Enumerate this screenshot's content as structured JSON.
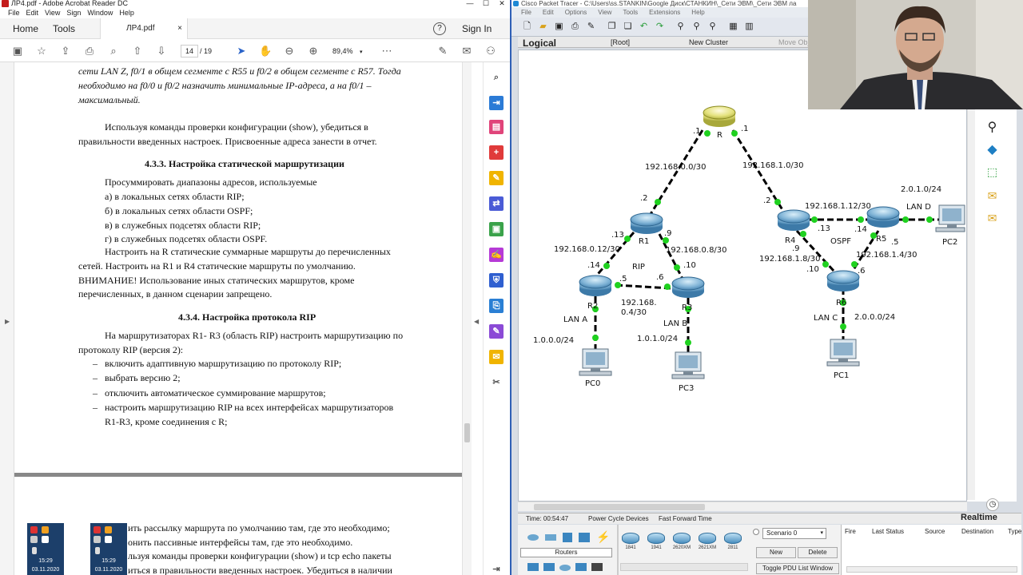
{
  "acrobat": {
    "window_title": "ЛР4.pdf - Adobe Acrobat Reader DC",
    "window_buttons": [
      "—",
      "☐",
      "✕"
    ],
    "menu": [
      "File",
      "Edit",
      "View",
      "Sign",
      "Window",
      "Help"
    ],
    "tabs": {
      "home": "Home",
      "tools": "Tools",
      "document": "ЛР4.pdf",
      "close": "×",
      "help": "?",
      "sign_in": "Sign In"
    },
    "toolbar": {
      "page_current": "14",
      "page_total": "/ 19",
      "zoom": "89,4%"
    },
    "page1": {
      "l1": "сети LAN Z, f0/1 в общем сегменте с R55 и f0/2 в общем сегменте с R57. Тогда",
      "l2": "необходимо на f0/0 и f0/2 назначить минимальные IP-адреса, а на f0/1 –",
      "l3": "максимальный.",
      "l4": "Используя команды проверки конфигурации (show), убедиться в",
      "l5": "правильности введенных настроек. Присвоенные адреса занести в отчет.",
      "h1": "4.3.3. Настройка статической маршрутизации",
      "l6": "Просуммировать диапазоны адресов, используемые",
      "l7": "а) в локальных сетях области RIP;",
      "l8": "б) в локальных сетях области OSPF;",
      "l9": "в) в служебных подсетях области RIP;",
      "l10": "г) в служебных подсетях области OSPF.",
      "l11": "Настроить на R статические суммарные маршруты до перечисленных",
      "l12": "сетей. Настроить на R1 и R4 статические маршруты по умолчанию.",
      "l13": "ВНИМАНИЕ! Использование иных статических маршрутов, кроме",
      "l14": "перечисленных, в данном сценарии запрещено.",
      "h2": "4.3.4. Настройка протокола RIP",
      "l15": "На маршрутизаторах R1- R3 (область RIP) настроить маршрутизацию по",
      "l16": "протоколу RIP (версия 2):",
      "b1": "включить адаптивную маршрутизацию по протоколу RIP;",
      "b2": "выбрать версию 2;",
      "b3": "отключить автоматическое суммирование маршрутов;",
      "b4": "настроить маршрутизацию RIP на всех интерфейсах маршрутизаторов",
      "b4b": "R1-R3, кроме соединения с R;",
      "dash": "–"
    },
    "page2": {
      "l1": "ить рассылку маршрута по умолчанию там, где это необходимо;",
      "l2": "онить пассивные интерфейсы там, где это необходимо.",
      "l3": "льзуя команды проверки конфигурации (show) и tcp echo пакеты",
      "l4": "иться в правильности введенных настроек. Убедиться в наличии"
    },
    "thumbnails": [
      {
        "time": "15:29",
        "date": "03.11.2020"
      },
      {
        "time": "15:29",
        "date": "03.11.2020"
      }
    ]
  },
  "packet_tracer": {
    "window_title": "Cisco Packet Tracer - C:\\Users\\ss.STANKIN\\Google Диск\\СТАНКИН\\_Сети ЭВМ\\_Сети ЭВМ ла",
    "menu": [
      "File",
      "Edit",
      "Options",
      "View",
      "Tools",
      "Extensions",
      "Help"
    ],
    "bar2": {
      "logical": "Logical",
      "root": "[Root]",
      "new_cluster": "New Cluster",
      "move_obj": "Move Obj"
    },
    "network": {
      "routers": {
        "R": "R",
        "R1": "R1",
        "R2": "R2",
        "R3": "R3",
        "R4": "R4",
        "R5": "R5",
        "R6": "R6"
      },
      "pcs": {
        "PC0": "PC0",
        "PC1": "PC1",
        "PC2": "PC2",
        "PC3": "PC3"
      },
      "subnets": {
        "s1": "192.168.0.0/30",
        "s2": "192.168.1.0/30",
        "s3": "192.168.1.12/30",
        "s4": "192.168.0.12/30",
        "s5": "192.168.0.8/30",
        "s6": "192.168.1.8/30",
        "s7": "192.168.1.4/30",
        "s8a": "192.168.",
        "s8b": "0.4/30",
        "lan_d": "2.0.1.0/24",
        "lan_a": "1.0.0.0/24",
        "lan_b": "1.0.1.0/24",
        "lan_c": "2.0.0.0/24"
      },
      "areas": {
        "rip": "RIP",
        "ospf": "OSPF"
      },
      "lans": {
        "a": "LAN A",
        "b": "LAN B",
        "c": "LAN C",
        "d": "LAN D"
      },
      "ifaces": {
        "r_left": ".1",
        "r_right": ".1",
        "r1_top": ".2",
        "r4_top": ".2",
        "r1_left": ".13",
        "r1_right": ".9",
        "r4_right": ".13",
        "r5_left": ".14",
        "r2_top": ".14",
        "r3_top": ".10",
        "r2_right": ".5",
        "r3_left": ".6",
        "r4_bottom": ".9",
        "r6_left": ".10",
        "r6_right": ".6",
        "r5_bottom": ".5"
      }
    },
    "status": {
      "time": "Time: 00:54:47",
      "power": "Power Cycle Devices",
      "fast": "Fast Forward Time",
      "realtime": "Realtime"
    },
    "bottom": {
      "category": "Routers",
      "devices": [
        "1841",
        "1941",
        "2620XM",
        "2621XM",
        "2811"
      ],
      "scenario": "Scenario 0",
      "new": "New",
      "delete": "Delete",
      "toggle": "Toggle PDU List Window",
      "pdu_headers": [
        "Fire",
        "Last Status",
        "Source",
        "Destination",
        "Type"
      ]
    }
  }
}
